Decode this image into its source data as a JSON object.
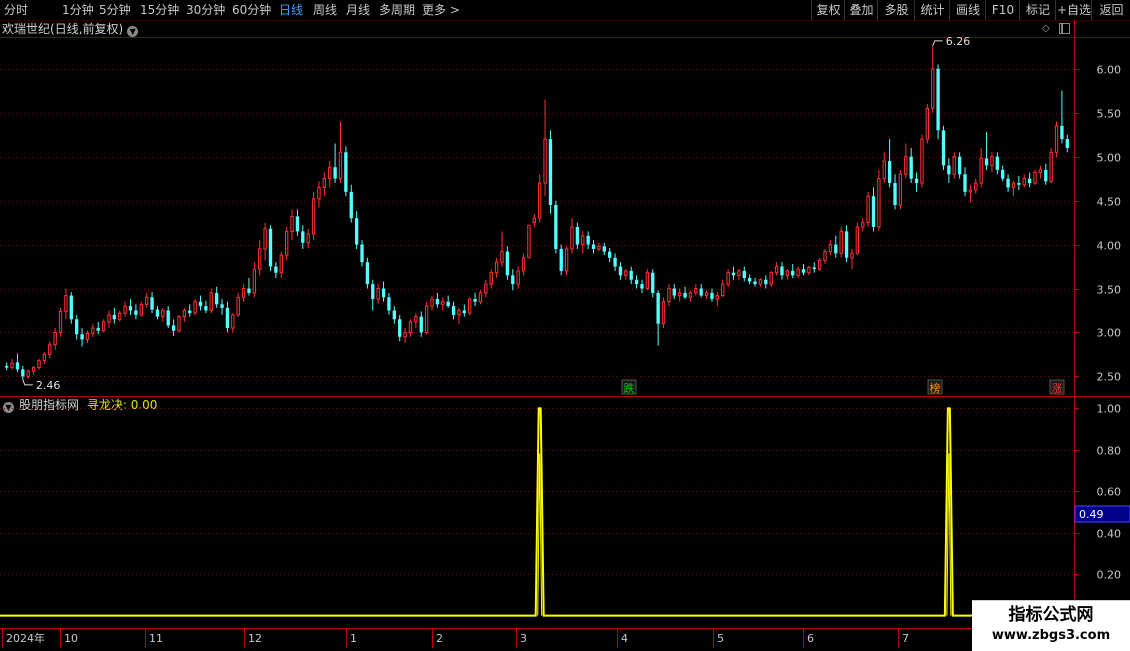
{
  "toolbar": {
    "periods": [
      "分时",
      "1分钟",
      "5分钟",
      "15分钟",
      "30分钟",
      "60分钟",
      "日线",
      "周线",
      "月线",
      "多周期",
      "更多 >"
    ],
    "active_period": "日线",
    "tools": [
      "复权",
      "叠加",
      "多股",
      "统计",
      "画线",
      "F10",
      "标记",
      "+自选",
      "返回"
    ]
  },
  "stock": {
    "name": "欢瑞世纪",
    "mode": "(日线,前复权)",
    "high_label": "6.26",
    "low_label": "2.46"
  },
  "indicator": {
    "source": "股朋指标网",
    "name": "寻龙决",
    "value": "0.00",
    "cursor_value": "0.49"
  },
  "events": [
    {
      "label": "跌",
      "color": "#00c800"
    },
    {
      "label": "榜",
      "color": "#ff9900"
    },
    {
      "label": "涨",
      "color": "#ff3030"
    }
  ],
  "watermark": {
    "line1": "指标公式网",
    "line2": "www.zbgs3.com"
  },
  "colors": {
    "up": "#ff3232",
    "down": "#54ffff",
    "signal": "#ffff00",
    "grid": "#8b0000",
    "axis_text": "#c8c8c8"
  },
  "chart_data": [
    {
      "type": "candlestick",
      "title": "欢瑞世纪(日线,前复权)",
      "y_ticks": [
        2.5,
        3.0,
        3.5,
        4.0,
        4.5,
        5.0,
        5.5,
        6.0
      ],
      "ylim": [
        2.3,
        6.35
      ],
      "x_ticks": [
        "2024年",
        "10",
        "11",
        "12",
        "1",
        "2",
        "3",
        "4",
        "5",
        "6",
        "7"
      ],
      "grid": true,
      "ohlc": [
        [
          2.62,
          2.66,
          2.57,
          2.6
        ],
        [
          2.6,
          2.7,
          2.58,
          2.65
        ],
        [
          2.66,
          2.76,
          2.55,
          2.58
        ],
        [
          2.58,
          2.62,
          2.46,
          2.5
        ],
        [
          2.5,
          2.58,
          2.47,
          2.56
        ],
        [
          2.56,
          2.62,
          2.52,
          2.6
        ],
        [
          2.6,
          2.7,
          2.58,
          2.68
        ],
        [
          2.68,
          2.78,
          2.64,
          2.75
        ],
        [
          2.75,
          2.9,
          2.7,
          2.86
        ],
        [
          2.86,
          3.05,
          2.8,
          3.0
        ],
        [
          3.0,
          3.28,
          2.95,
          3.24
        ],
        [
          3.24,
          3.5,
          3.15,
          3.42
        ],
        [
          3.42,
          3.46,
          3.1,
          3.15
        ],
        [
          3.15,
          3.2,
          2.92,
          2.98
        ],
        [
          2.98,
          3.05,
          2.84,
          2.92
        ],
        [
          2.92,
          3.02,
          2.88,
          2.99
        ],
        [
          2.99,
          3.1,
          2.95,
          3.05
        ],
        [
          3.05,
          3.12,
          2.98,
          3.02
        ],
        [
          3.02,
          3.15,
          3.0,
          3.12
        ],
        [
          3.12,
          3.25,
          3.05,
          3.2
        ],
        [
          3.2,
          3.28,
          3.1,
          3.15
        ],
        [
          3.15,
          3.25,
          3.12,
          3.22
        ],
        [
          3.22,
          3.35,
          3.18,
          3.3
        ],
        [
          3.3,
          3.38,
          3.2,
          3.25
        ],
        [
          3.25,
          3.32,
          3.15,
          3.2
        ],
        [
          3.2,
          3.35,
          3.18,
          3.32
        ],
        [
          3.32,
          3.45,
          3.28,
          3.4
        ],
        [
          3.4,
          3.46,
          3.22,
          3.26
        ],
        [
          3.26,
          3.3,
          3.15,
          3.18
        ],
        [
          3.18,
          3.28,
          3.12,
          3.25
        ],
        [
          3.25,
          3.3,
          3.05,
          3.08
        ],
        [
          3.08,
          3.15,
          2.96,
          3.02
        ],
        [
          3.02,
          3.2,
          3.0,
          3.18
        ],
        [
          3.18,
          3.28,
          3.12,
          3.25
        ],
        [
          3.25,
          3.32,
          3.18,
          3.22
        ],
        [
          3.22,
          3.38,
          3.2,
          3.35
        ],
        [
          3.35,
          3.42,
          3.25,
          3.3
        ],
        [
          3.3,
          3.36,
          3.22,
          3.25
        ],
        [
          3.25,
          3.5,
          3.22,
          3.45
        ],
        [
          3.45,
          3.52,
          3.28,
          3.32
        ],
        [
          3.32,
          3.38,
          3.2,
          3.28
        ],
        [
          3.28,
          3.35,
          3.0,
          3.05
        ],
        [
          3.05,
          3.22,
          3.0,
          3.2
        ],
        [
          3.2,
          3.45,
          3.18,
          3.4
        ],
        [
          3.4,
          3.55,
          3.35,
          3.5
        ],
        [
          3.5,
          3.62,
          3.42,
          3.45
        ],
        [
          3.45,
          3.8,
          3.4,
          3.72
        ],
        [
          3.72,
          4.05,
          3.65,
          3.95
        ],
        [
          3.95,
          4.25,
          3.82,
          4.18
        ],
        [
          4.18,
          4.22,
          3.7,
          3.75
        ],
        [
          3.75,
          3.8,
          3.62,
          3.68
        ],
        [
          3.68,
          3.92,
          3.62,
          3.88
        ],
        [
          3.88,
          4.2,
          3.82,
          4.15
        ],
        [
          4.15,
          4.4,
          4.05,
          4.32
        ],
        [
          4.32,
          4.4,
          4.1,
          4.15
        ],
        [
          4.15,
          4.22,
          3.95,
          4.02
        ],
        [
          4.02,
          4.18,
          3.96,
          4.12
        ],
        [
          4.12,
          4.6,
          4.05,
          4.52
        ],
        [
          4.52,
          4.72,
          4.42,
          4.65
        ],
        [
          4.65,
          4.82,
          4.55,
          4.75
        ],
        [
          4.75,
          4.95,
          4.65,
          4.88
        ],
        [
          4.88,
          5.15,
          4.7,
          4.75
        ],
        [
          4.75,
          5.4,
          4.7,
          5.05
        ],
        [
          5.05,
          5.12,
          4.55,
          4.6
        ],
        [
          4.6,
          4.68,
          4.25,
          4.3
        ],
        [
          4.3,
          4.38,
          3.95,
          4.0
        ],
        [
          4.0,
          4.05,
          3.75,
          3.8
        ],
        [
          3.8,
          3.85,
          3.5,
          3.55
        ],
        [
          3.55,
          3.6,
          3.25,
          3.38
        ],
        [
          3.38,
          3.55,
          3.32,
          3.5
        ],
        [
          3.5,
          3.58,
          3.35,
          3.4
        ],
        [
          3.4,
          3.45,
          3.2,
          3.25
        ],
        [
          3.25,
          3.3,
          3.1,
          3.15
        ],
        [
          3.15,
          3.2,
          2.9,
          2.95
        ],
        [
          2.95,
          3.05,
          2.88,
          3.0
        ],
        [
          3.0,
          3.15,
          2.95,
          3.12
        ],
        [
          3.12,
          3.22,
          3.05,
          3.18
        ],
        [
          3.18,
          3.24,
          2.95,
          3.0
        ],
        [
          3.0,
          3.35,
          2.98,
          3.3
        ],
        [
          3.3,
          3.42,
          3.25,
          3.38
        ],
        [
          3.38,
          3.45,
          3.28,
          3.32
        ],
        [
          3.32,
          3.4,
          3.25,
          3.35
        ],
        [
          3.35,
          3.42,
          3.28,
          3.3
        ],
        [
          3.3,
          3.35,
          3.15,
          3.2
        ],
        [
          3.2,
          3.28,
          3.1,
          3.25
        ],
        [
          3.25,
          3.32,
          3.18,
          3.22
        ],
        [
          3.22,
          3.4,
          3.2,
          3.38
        ],
        [
          3.38,
          3.45,
          3.3,
          3.35
        ],
        [
          3.35,
          3.48,
          3.32,
          3.45
        ],
        [
          3.45,
          3.6,
          3.4,
          3.55
        ],
        [
          3.55,
          3.72,
          3.5,
          3.68
        ],
        [
          3.68,
          3.85,
          3.62,
          3.8
        ],
        [
          3.8,
          4.15,
          3.75,
          3.92
        ],
        [
          3.92,
          3.98,
          3.6,
          3.65
        ],
        [
          3.65,
          3.72,
          3.48,
          3.55
        ],
        [
          3.55,
          3.75,
          3.5,
          3.7
        ],
        [
          3.7,
          3.9,
          3.65,
          3.85
        ],
        [
          3.85,
          4.2,
          4.18,
          4.22
        ],
        [
          4.25,
          4.35,
          4.2,
          4.3
        ],
        [
          4.3,
          4.8,
          4.25,
          4.7
        ],
        [
          4.7,
          5.65,
          4.55,
          5.2
        ],
        [
          5.2,
          5.3,
          4.35,
          4.45
        ],
        [
          4.45,
          4.5,
          3.9,
          3.95
        ],
        [
          3.95,
          4.0,
          3.65,
          3.7
        ],
        [
          3.7,
          3.98,
          3.65,
          3.95
        ],
        [
          3.95,
          4.3,
          3.9,
          4.2
        ],
        [
          4.2,
          4.25,
          3.95,
          4.0
        ],
        [
          4.0,
          4.15,
          3.9,
          4.1
        ],
        [
          4.1,
          4.15,
          3.95,
          4.0
        ],
        [
          4.0,
          4.05,
          3.9,
          3.95
        ],
        [
          3.95,
          4.02,
          3.92,
          3.98
        ],
        [
          3.98,
          4.02,
          3.88,
          3.92
        ],
        [
          3.92,
          3.96,
          3.8,
          3.85
        ],
        [
          3.85,
          3.9,
          3.7,
          3.75
        ],
        [
          3.75,
          3.8,
          3.6,
          3.65
        ],
        [
          3.65,
          3.72,
          3.6,
          3.7
        ],
        [
          3.7,
          3.75,
          3.55,
          3.6
        ],
        [
          3.6,
          3.65,
          3.5,
          3.55
        ],
        [
          3.55,
          3.6,
          3.45,
          3.5
        ],
        [
          3.5,
          3.72,
          3.48,
          3.68
        ],
        [
          3.68,
          3.72,
          3.4,
          3.45
        ],
        [
          3.45,
          3.48,
          2.85,
          3.1
        ],
        [
          3.1,
          3.4,
          3.05,
          3.35
        ],
        [
          3.35,
          3.55,
          3.3,
          3.5
        ],
        [
          3.5,
          3.55,
          3.38,
          3.42
        ],
        [
          3.42,
          3.5,
          3.35,
          3.45
        ],
        [
          3.45,
          3.52,
          3.38,
          3.4
        ],
        [
          3.4,
          3.48,
          3.35,
          3.45
        ],
        [
          3.45,
          3.55,
          3.42,
          3.5
        ],
        [
          3.5,
          3.55,
          3.4,
          3.42
        ],
        [
          3.42,
          3.48,
          3.38,
          3.45
        ],
        [
          3.45,
          3.5,
          3.35,
          3.38
        ],
        [
          3.38,
          3.46,
          3.3,
          3.42
        ],
        [
          3.42,
          3.6,
          3.4,
          3.55
        ],
        [
          3.55,
          3.72,
          3.52,
          3.68
        ],
        [
          3.68,
          3.75,
          3.6,
          3.65
        ],
        [
          3.65,
          3.72,
          3.6,
          3.7
        ],
        [
          3.7,
          3.75,
          3.58,
          3.62
        ],
        [
          3.62,
          3.66,
          3.55,
          3.58
        ],
        [
          3.58,
          3.62,
          3.52,
          3.55
        ],
        [
          3.55,
          3.62,
          3.52,
          3.6
        ],
        [
          3.6,
          3.65,
          3.5,
          3.55
        ],
        [
          3.55,
          3.7,
          3.52,
          3.68
        ],
        [
          3.68,
          3.8,
          3.65,
          3.75
        ],
        [
          3.75,
          3.8,
          3.6,
          3.65
        ],
        [
          3.65,
          3.72,
          3.6,
          3.7
        ],
        [
          3.7,
          3.78,
          3.62,
          3.65
        ],
        [
          3.65,
          3.75,
          3.62,
          3.72
        ],
        [
          3.72,
          3.78,
          3.65,
          3.68
        ],
        [
          3.68,
          3.76,
          3.65,
          3.74
        ],
        [
          3.74,
          3.8,
          3.68,
          3.72
        ],
        [
          3.72,
          3.85,
          3.7,
          3.82
        ],
        [
          3.82,
          3.95,
          3.78,
          3.92
        ],
        [
          3.92,
          4.05,
          3.88,
          4.0
        ],
        [
          4.0,
          4.1,
          3.85,
          3.9
        ],
        [
          3.9,
          4.2,
          3.85,
          4.15
        ],
        [
          4.15,
          4.22,
          3.8,
          3.85
        ],
        [
          3.85,
          3.95,
          3.72,
          3.9
        ],
        [
          3.9,
          4.25,
          3.88,
          4.2
        ],
        [
          4.2,
          4.3,
          4.15,
          4.25
        ],
        [
          4.25,
          4.6,
          4.2,
          4.55
        ],
        [
          4.55,
          4.65,
          4.15,
          4.2
        ],
        [
          4.2,
          4.85,
          4.15,
          4.75
        ],
        [
          4.75,
          5.05,
          4.7,
          4.95
        ],
        [
          4.95,
          5.2,
          4.65,
          4.7
        ],
        [
          4.7,
          4.8,
          4.4,
          4.45
        ],
        [
          4.45,
          4.85,
          4.4,
          4.8
        ],
        [
          4.8,
          5.15,
          4.75,
          5.0
        ],
        [
          5.0,
          5.1,
          4.7,
          4.75
        ],
        [
          4.75,
          4.82,
          4.6,
          4.7
        ],
        [
          4.7,
          5.25,
          4.65,
          5.2
        ],
        [
          5.2,
          5.6,
          5.15,
          5.55
        ],
        [
          5.55,
          6.26,
          5.5,
          6.0
        ],
        [
          6.0,
          6.05,
          5.2,
          5.3
        ],
        [
          5.3,
          5.35,
          4.85,
          4.9
        ],
        [
          4.9,
          4.98,
          4.7,
          4.8
        ],
        [
          4.8,
          5.05,
          4.75,
          5.0
        ],
        [
          5.0,
          5.05,
          4.75,
          4.8
        ],
        [
          4.8,
          4.88,
          4.55,
          4.6
        ],
        [
          4.6,
          4.68,
          4.48,
          4.62
        ],
        [
          4.62,
          4.75,
          4.58,
          4.7
        ],
        [
          4.7,
          5.1,
          4.65,
          4.98
        ],
        [
          4.98,
          5.28,
          4.85,
          4.9
        ],
        [
          4.9,
          5.05,
          4.82,
          5.0
        ],
        [
          5.0,
          5.05,
          4.8,
          4.85
        ],
        [
          4.85,
          4.9,
          4.72,
          4.75
        ],
        [
          4.75,
          4.8,
          4.6,
          4.65
        ],
        [
          4.65,
          4.72,
          4.55,
          4.7
        ],
        [
          4.7,
          4.78,
          4.62,
          4.68
        ],
        [
          4.68,
          4.8,
          4.65,
          4.75
        ],
        [
          4.75,
          4.82,
          4.65,
          4.7
        ],
        [
          4.7,
          4.85,
          4.68,
          4.82
        ],
        [
          4.82,
          4.9,
          4.75,
          4.85
        ],
        [
          4.85,
          4.92,
          4.68,
          4.72
        ],
        [
          4.72,
          5.1,
          4.7,
          5.05
        ],
        [
          5.05,
          5.4,
          5.0,
          5.35
        ],
        [
          5.35,
          5.75,
          5.15,
          5.2
        ],
        [
          5.2,
          5.25,
          5.05,
          5.1
        ]
      ]
    },
    {
      "type": "line",
      "title": "寻龙决",
      "y_ticks": [
        0.2,
        0.4,
        0.6,
        0.8,
        1.0
      ],
      "ylim": [
        -0.05,
        1.05
      ],
      "series": [
        {
          "name": "寻龙决",
          "spikes_at_index": [
            99,
            175
          ],
          "spike_value": 1.0,
          "baseline": 0.0
        }
      ]
    }
  ]
}
